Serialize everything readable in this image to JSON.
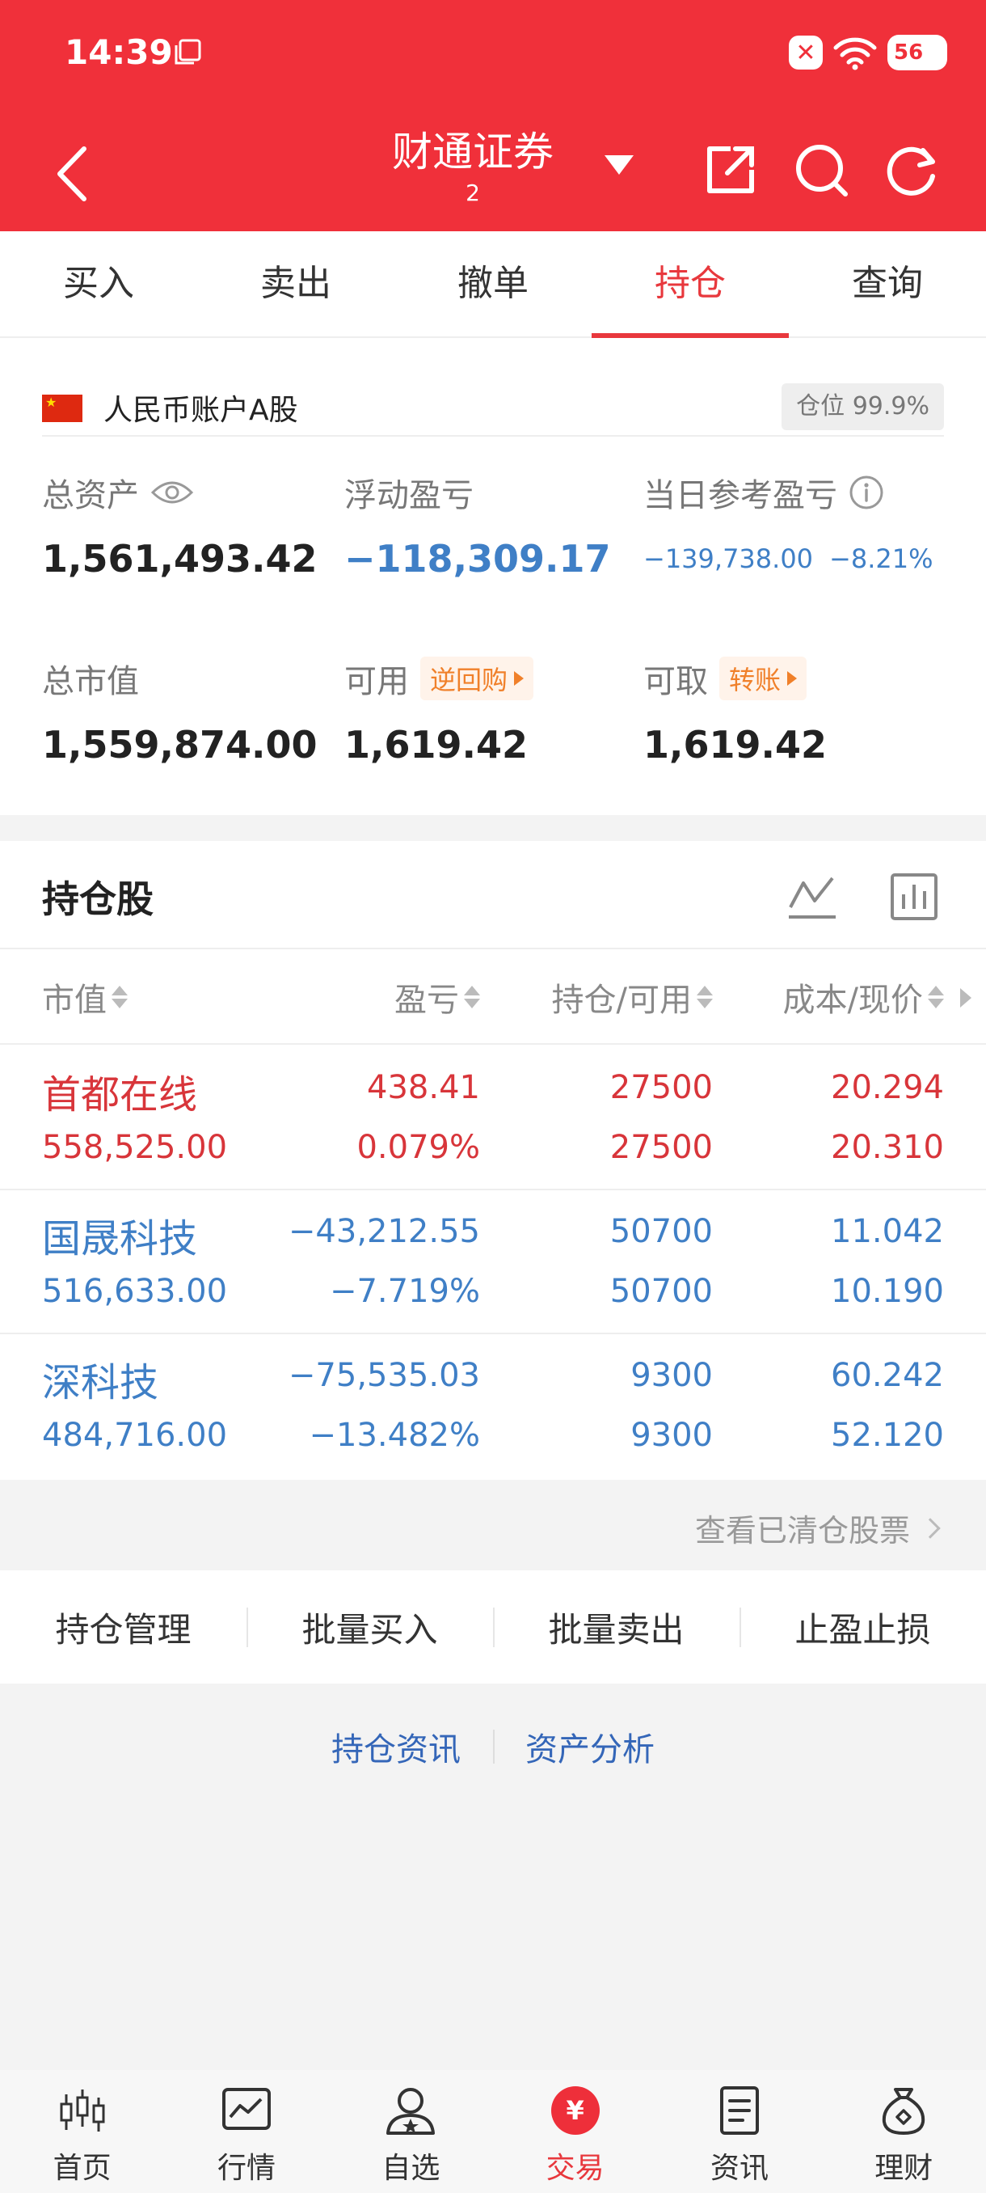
{
  "status_bar": {
    "time": "14:39",
    "battery": "56"
  },
  "nav": {
    "title": "财通证券",
    "subtitle": "2"
  },
  "tabs": [
    {
      "label": "买入"
    },
    {
      "label": "卖出"
    },
    {
      "label": "撤单"
    },
    {
      "label": "持仓",
      "active": true
    },
    {
      "label": "查询"
    }
  ],
  "account": {
    "name": "人民币账户A股",
    "position_ratio": "仓位 99.9%",
    "total_assets_label": "总资产",
    "total_assets": "1,561,493.42",
    "floating_pl_label": "浮动盈亏",
    "floating_pl": "−118,309.17",
    "daily_pl_label": "当日参考盈亏",
    "daily_pl": "−139,738.00",
    "daily_pl_pct": "−8.21%",
    "market_value_label": "总市值",
    "market_value": "1,559,874.00",
    "available_label": "可用",
    "available": "1,619.42",
    "reverse_repo": "逆回购",
    "withdrawable_label": "可取",
    "withdrawable": "1,619.42",
    "transfer": "转账"
  },
  "holdings": {
    "title": "持仓股",
    "columns": {
      "market_value": "市值",
      "pl": "盈亏",
      "position": "持仓/可用",
      "cost_price": "成本/现价"
    },
    "rows": [
      {
        "name": "首都在线",
        "market_value": "558,525.00",
        "pl": "438.41",
        "pl_pct": "0.079%",
        "position": "27500",
        "available": "27500",
        "cost": "20.294",
        "price": "20.310",
        "color": "#d8353a"
      },
      {
        "name": "国晟科技",
        "market_value": "516,633.00",
        "pl": "−43,212.55",
        "pl_pct": "−7.719%",
        "position": "50700",
        "available": "50700",
        "cost": "11.042",
        "price": "10.190",
        "color": "#3f7fc6"
      },
      {
        "name": "深科技",
        "market_value": "484,716.00",
        "pl": "−75,535.03",
        "pl_pct": "−13.482%",
        "position": "9300",
        "available": "9300",
        "cost": "60.242",
        "price": "52.120",
        "color": "#3f7fc6"
      }
    ],
    "view_cleared": "查看已清仓股票"
  },
  "actions": {
    "manage": "持仓管理",
    "batch_buy": "批量买入",
    "batch_sell": "批量卖出",
    "stop": "止盈止损"
  },
  "links": {
    "news": "持仓资讯",
    "analysis": "资产分析"
  },
  "bottom_nav": [
    {
      "label": "首页",
      "icon": "candlestick-icon"
    },
    {
      "label": "行情",
      "icon": "chart-icon"
    },
    {
      "label": "自选",
      "icon": "user-star-icon"
    },
    {
      "label": "交易",
      "icon": "yen-icon",
      "active": true
    },
    {
      "label": "资讯",
      "icon": "document-icon"
    },
    {
      "label": "理财",
      "icon": "money-bag-icon"
    }
  ],
  "colors": {
    "brand": "#f0303a",
    "up": "#d8353a",
    "down": "#3f7fc6",
    "tag": "#f0802a"
  }
}
